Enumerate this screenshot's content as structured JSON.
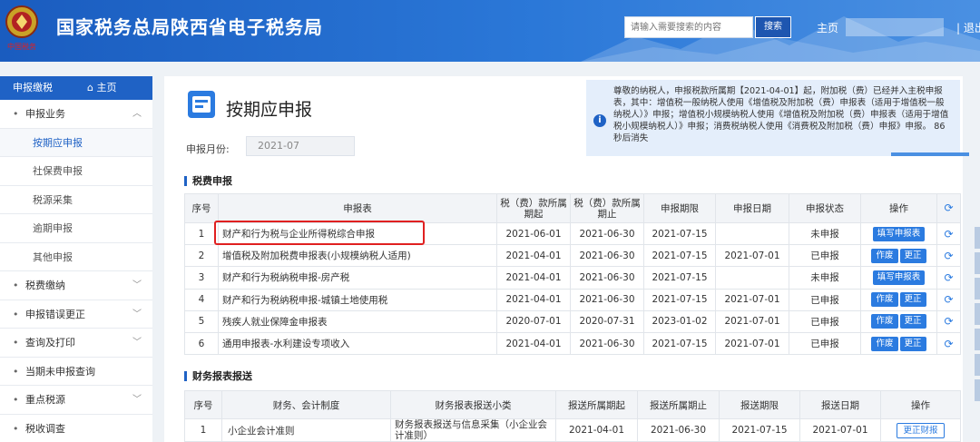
{
  "header": {
    "emblem_caption": "中国税务",
    "title": "国家税务总局陕西省电子税务局",
    "search_placeholder": "请输入需要搜索的内容",
    "search_button": "搜索",
    "home": "主页",
    "logout": "| 退出"
  },
  "sidebar": {
    "header": "申报缴税",
    "home_link": "主页",
    "items": [
      {
        "label": "申报业务",
        "type": "group",
        "expandable": true
      },
      {
        "label": "按期应申报",
        "type": "sub",
        "active": true
      },
      {
        "label": "社保费申报",
        "type": "sub"
      },
      {
        "label": "税源采集",
        "type": "sub"
      },
      {
        "label": "逾期申报",
        "type": "sub"
      },
      {
        "label": "其他申报",
        "type": "sub"
      },
      {
        "label": "税费缴纳",
        "type": "group",
        "expandable": true
      },
      {
        "label": "申报错误更正",
        "type": "group",
        "expandable": true
      },
      {
        "label": "查询及打印",
        "type": "group",
        "expandable": true
      },
      {
        "label": "当期未申报查询",
        "type": "group"
      },
      {
        "label": "重点税源",
        "type": "group",
        "expandable": true
      },
      {
        "label": "税收调查",
        "type": "group"
      }
    ]
  },
  "page": {
    "title": "按期应申报",
    "month_label": "申报月份:",
    "month_value": "2021-07"
  },
  "notice": {
    "text": "尊敬的纳税人，申报税款所属期【2021-04-01】起，附加税（费）已经并入主税申报表，其中：增值税一般纳税人使用《增值税及附加税（费）申报表（适用于增值税一般纳税人）》申报；增值税小规模纳税人使用《增值税及附加税（费）申报表（适用于增值税小规模纳税人）》申报；消费税纳税人使用《消费税及附加税（费）申报》申报。 86秒后消失"
  },
  "tax_section": {
    "title": "税费申报",
    "headers": [
      "序号",
      "申报表",
      "税（费）款所属期起",
      "税（费）款所属期止",
      "申报期限",
      "申报日期",
      "申报状态",
      "操作"
    ],
    "rows": [
      {
        "no": "1",
        "name": "财产和行为税与企业所得税综合申报",
        "start": "2021-06-01",
        "end": "2021-06-30",
        "deadline": "2021-07-15",
        "date": "",
        "status": "未申报",
        "actions": [
          "填写申报表"
        ]
      },
      {
        "no": "2",
        "name": "增值税及附加税费申报表(小规模纳税人适用)",
        "start": "2021-04-01",
        "end": "2021-06-30",
        "deadline": "2021-07-15",
        "date": "2021-07-01",
        "status": "已申报",
        "actions": [
          "作废",
          "更正"
        ]
      },
      {
        "no": "3",
        "name": "财产和行为税纳税申报-房产税",
        "start": "2021-04-01",
        "end": "2021-06-30",
        "deadline": "2021-07-15",
        "date": "",
        "status": "未申报",
        "actions": [
          "填写申报表"
        ]
      },
      {
        "no": "4",
        "name": "财产和行为税纳税申报-城镇土地使用税",
        "start": "2021-04-01",
        "end": "2021-06-30",
        "deadline": "2021-07-15",
        "date": "2021-07-01",
        "status": "已申报",
        "actions": [
          "作废",
          "更正"
        ]
      },
      {
        "no": "5",
        "name": "残疾人就业保障金申报表",
        "start": "2020-07-01",
        "end": "2020-07-31",
        "deadline": "2023-01-02",
        "date": "2021-07-01",
        "status": "已申报",
        "actions": [
          "作废",
          "更正"
        ]
      },
      {
        "no": "6",
        "name": "通用申报表-水利建设专项收入",
        "start": "2021-04-01",
        "end": "2021-06-30",
        "deadline": "2021-07-15",
        "date": "2021-07-01",
        "status": "已申报",
        "actions": [
          "作废",
          "更正"
        ]
      }
    ]
  },
  "finance_section": {
    "title": "财务报表报送",
    "headers": [
      "序号",
      "财务、会计制度",
      "财务报表报送小类",
      "报送所属期起",
      "报送所属期止",
      "报送期限",
      "报送日期",
      "操作"
    ],
    "rows": [
      {
        "no": "1",
        "system": "小企业会计准则",
        "category": "财务报表报送与信息采集（小企业会计准则）",
        "start": "2021-04-01",
        "end": "2021-06-30",
        "deadline": "2021-07-15",
        "date": "2021-07-01",
        "action": "更正财报"
      }
    ]
  },
  "colors": {
    "header_blue": "#2b78d8",
    "accent": "#1f62c5",
    "button": "#2b7be0",
    "highlight": "#e02020"
  },
  "icons": {
    "refresh": "refresh-icon",
    "info": "info-icon",
    "home": "home-icon",
    "chevron": "chevron-down-icon"
  }
}
